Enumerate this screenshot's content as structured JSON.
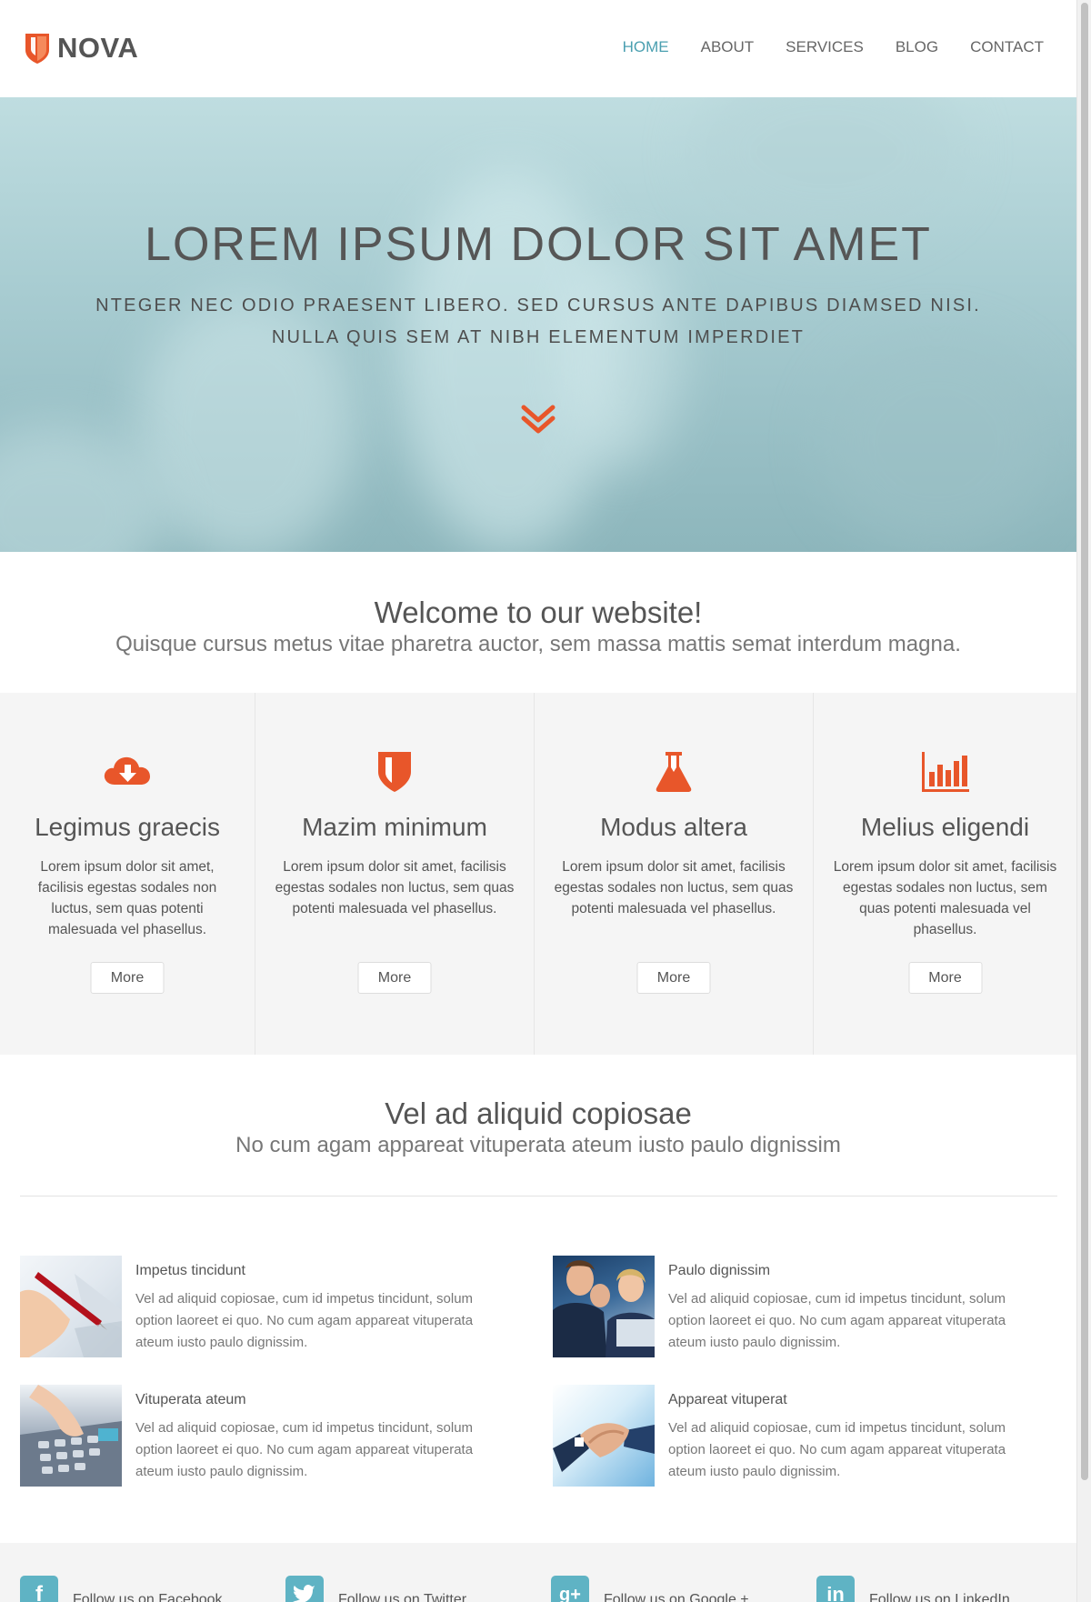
{
  "header": {
    "logo_text": "NOVA",
    "nav": [
      {
        "label": "HOME",
        "active": true
      },
      {
        "label": "ABOUT",
        "active": false
      },
      {
        "label": "SERVICES",
        "active": false
      },
      {
        "label": "BLOG",
        "active": false
      },
      {
        "label": "CONTACT",
        "active": false
      }
    ]
  },
  "hero": {
    "title": "LOREM IPSUM DOLOR SIT AMET",
    "subtitle_line1": "NTEGER NEC ODIO PRAESENT LIBERO. SED CURSUS ANTE DAPIBUS DIAMSED NISI.",
    "subtitle_line2": "NULLA QUIS SEM AT NIBH ELEMENTUM IMPERDIET",
    "scroll_icon": "chevron-double-down-icon"
  },
  "welcome": {
    "title": "Welcome to our website!",
    "subtitle": "Quisque cursus metus vitae pharetra auctor, sem massa mattis semat interdum magna."
  },
  "features": [
    {
      "icon": "cloud-download-icon",
      "title": "Legimus graecis",
      "text": "Lorem ipsum dolor sit amet, facilisis egestas sodales non luctus, sem quas potenti malesuada vel phasellus.",
      "button": "More"
    },
    {
      "icon": "shield-icon",
      "title": "Mazim minimum",
      "text": "Lorem ipsum dolor sit amet, facilisis egestas sodales non luctus, sem quas potenti malesuada vel phasellus.",
      "button": "More"
    },
    {
      "icon": "flask-icon",
      "title": "Modus altera",
      "text": "Lorem ipsum dolor sit amet, facilisis egestas sodales non luctus, sem quas potenti malesuada vel phasellus.",
      "button": "More"
    },
    {
      "icon": "bar-chart-icon",
      "title": "Melius eligendi",
      "text": "Lorem ipsum dolor sit amet, facilisis egestas sodales non luctus, sem quas potenti malesuada vel phasellus.",
      "button": "More"
    }
  ],
  "section2": {
    "title": "Vel ad aliquid copiosae",
    "subtitle": "No cum agam appareat vituperata ateum iusto paulo dignissim",
    "articles": [
      {
        "title": "Impetus tincidunt",
        "text": "Vel ad aliquid copiosae, cum id impetus tincidunt, solum option laoreet ei quo. No cum agam appareat vituperata ateum iusto paulo dignissim.",
        "image": "pen-and-chart-photo"
      },
      {
        "title": "Paulo dignissim",
        "text": "Vel ad aliquid copiosae, cum id impetus tincidunt, solum option laoreet ei quo. No cum agam appareat vituperata ateum iusto paulo dignissim.",
        "image": "business-team-photo"
      },
      {
        "title": "Vituperata ateum",
        "text": "Vel ad aliquid copiosae, cum id impetus tincidunt, solum option laoreet ei quo. No cum agam appareat vituperata ateum iusto paulo dignissim.",
        "image": "calculator-photo"
      },
      {
        "title": "Appareat vituperat",
        "text": "Vel ad aliquid copiosae, cum id impetus tincidunt, solum option laoreet ei quo. No cum agam appareat vituperata ateum iusto paulo dignissim.",
        "image": "handshake-photo"
      }
    ]
  },
  "footer": {
    "social": [
      {
        "icon": "facebook-icon",
        "label": "Follow us on Facebook"
      },
      {
        "icon": "twitter-icon",
        "label": "Follow us on Twitter"
      },
      {
        "icon": "google-plus-icon",
        "label": "Follow us on Google +"
      },
      {
        "icon": "linkedin-icon",
        "label": "Follow us on LinkedIn"
      }
    ]
  },
  "colors": {
    "accent": "#e8562a",
    "nav_active": "#4a9fb0",
    "social": "#5fb3c4"
  }
}
